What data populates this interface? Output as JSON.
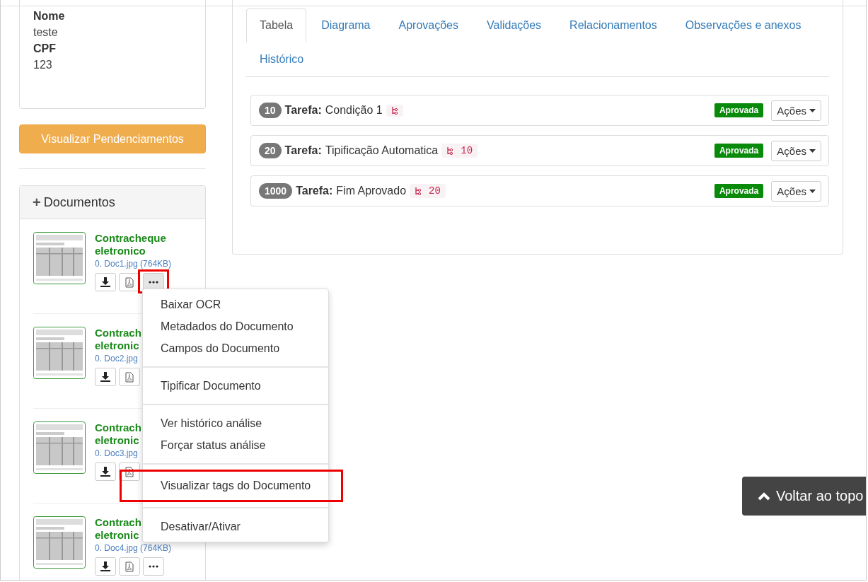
{
  "info_card": {
    "fields": [
      {
        "label": "Nome",
        "value": "teste"
      },
      {
        "label": "CPF",
        "value": "123"
      }
    ]
  },
  "pending_button": "Visualizar Pendenciamentos",
  "documents_panel": {
    "expand_icon": "+",
    "title": "Documentos",
    "items": [
      {
        "title_lines": [
          "Contracheque",
          "eletronico"
        ],
        "file": "0. Doc1.jpg (764KB)",
        "more_button": true,
        "more_highlighted": true
      },
      {
        "title_lines": [
          "Contrach",
          "eletronic"
        ],
        "file": "0. Doc2.jpg",
        "more_button": false
      },
      {
        "title_lines": [
          "Contrach",
          "eletronic"
        ],
        "file": "0. Doc3.jpg",
        "more_button": false
      },
      {
        "title_lines": [
          "Contrach",
          "eletronic"
        ],
        "file": "0. Doc4.jpg (764KB)",
        "more_button": true,
        "more_highlighted": false
      }
    ]
  },
  "context_menu": {
    "groups": [
      [
        {
          "label": "Baixar OCR",
          "highlighted": false
        },
        {
          "label": "Metadados do Documento",
          "highlighted": false
        },
        {
          "label": "Campos do Documento",
          "highlighted": false
        }
      ],
      [
        {
          "label": "Tipificar Documento",
          "highlighted": false
        }
      ],
      [
        {
          "label": "Ver histórico análise",
          "highlighted": false
        },
        {
          "label": "Forçar status análise",
          "highlighted": false
        }
      ],
      [
        {
          "label": "Visualizar tags do Documento",
          "highlighted": true
        }
      ],
      [
        {
          "label": "Desativar/Ativar",
          "highlighted": false
        }
      ]
    ]
  },
  "tabs": [
    {
      "label": "Tabela",
      "selected": true
    },
    {
      "label": "Diagrama",
      "selected": false
    },
    {
      "label": "Aprovações",
      "selected": false
    },
    {
      "label": "Validações",
      "selected": false
    },
    {
      "label": "Relacionamentos",
      "selected": false
    },
    {
      "label": "Observações e anexos",
      "selected": false
    },
    {
      "label": "Histórico",
      "selected": false
    }
  ],
  "tasks": [
    {
      "order": "10",
      "prefix": "Tarefa:",
      "name": "Condição 1",
      "status": "Aprovada",
      "actions": "Ações"
    },
    {
      "order": "20",
      "prefix": "Tarefa:",
      "name": "Tipificação Automatica",
      "depends_on": "10",
      "status": "Aprovada",
      "actions": "Ações"
    },
    {
      "order": "1000",
      "prefix": "Tarefa:",
      "name": "Fim Aprovado",
      "depends_on": "20",
      "status": "Aprovada",
      "actions": "Ações"
    }
  ],
  "back_to_top": "Voltar ao topo"
}
